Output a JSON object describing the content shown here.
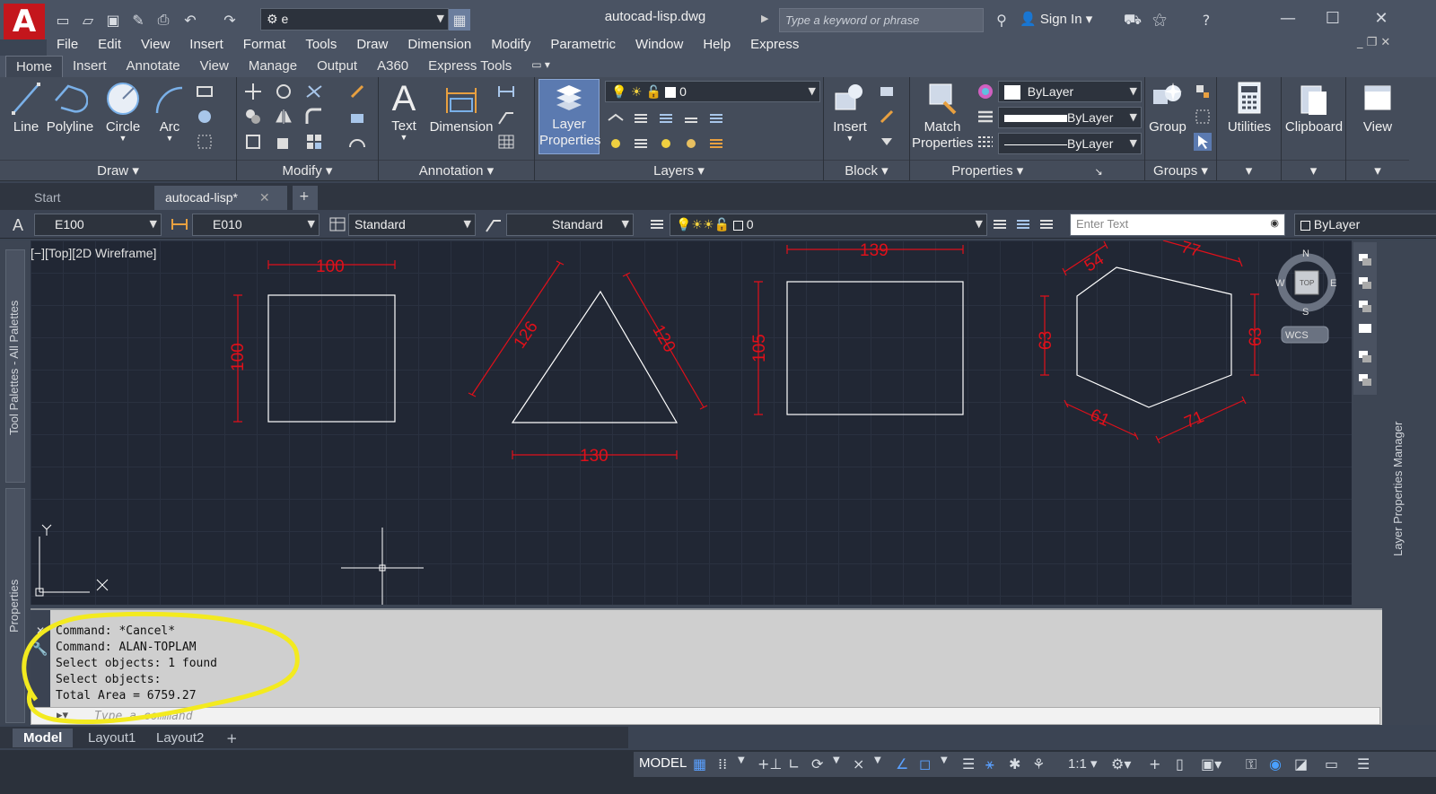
{
  "title_bar": {
    "app_logo": "A",
    "workspace": "e",
    "document_title": "autocad-lisp.dwg",
    "search_placeholder": "Type a keyword or phrase",
    "sign_in": "Sign In"
  },
  "menu": [
    "File",
    "Edit",
    "View",
    "Insert",
    "Format",
    "Tools",
    "Draw",
    "Dimension",
    "Modify",
    "Parametric",
    "Window",
    "Help",
    "Express"
  ],
  "ribbon_tabs": [
    "Home",
    "Insert",
    "Annotate",
    "View",
    "Manage",
    "Output",
    "A360",
    "Express Tools"
  ],
  "ribbon": {
    "draw": {
      "line": "Line",
      "polyline": "Polyline",
      "circle": "Circle",
      "arc": "Arc",
      "panel": "Draw"
    },
    "modify": {
      "panel": "Modify"
    },
    "annotation": {
      "text": "Text",
      "dimension": "Dimension",
      "panel": "Annotation"
    },
    "layers": {
      "layer_properties_1": "Layer",
      "layer_properties_2": "Properties",
      "current_layer": "0",
      "panel": "Layers"
    },
    "block": {
      "insert": "Insert",
      "panel": "Block"
    },
    "properties": {
      "match_1": "Match",
      "match_2": "Properties",
      "color": "ByLayer",
      "lineweight": "ByLayer",
      "linetype": "ByLayer",
      "panel": "Properties"
    },
    "groups": {
      "group": "Group",
      "panel": "Groups"
    },
    "utilities": "Utilities",
    "clipboard": "Clipboard",
    "view": "View"
  },
  "file_tabs": {
    "start": "Start",
    "current": "autocad-lisp*"
  },
  "prop_bar": {
    "text_style": "E100",
    "dim_style": "E010",
    "table_style": "Standard",
    "mleader_style": "Standard",
    "layer": "0",
    "enter_text_placeholder": "Enter Text",
    "bylayer": "ByLayer"
  },
  "viewport": {
    "label": "[−][Top][2D Wireframe]",
    "viewcube": {
      "top": "TOP",
      "n": "N",
      "s": "S",
      "e": "E",
      "w": "W",
      "wcs": "WCS"
    },
    "ucs": {
      "x": "X",
      "y": "Y"
    }
  },
  "drawing": {
    "square": {
      "width": "100",
      "height": "100"
    },
    "triangle": {
      "left": "126",
      "right": "120",
      "base": "130"
    },
    "rectangle": {
      "width": "139",
      "height": "105"
    },
    "hexagon": {
      "top_left": "54",
      "top_right": "77",
      "left": "63",
      "right": "63",
      "bottom_left": "61",
      "bottom_right": "71"
    },
    "colors": {
      "geometry": "#ffffff",
      "dimension": "#e0101a"
    }
  },
  "palettes": {
    "tool_palettes": "Tool Palettes - All Palettes",
    "properties": "Properties",
    "layer_manager": "Layer Properties Manager"
  },
  "command_history": [
    "Command: *Cancel*",
    "Command: ALAN-TOPLAM",
    "Select objects: 1 found",
    "Select objects:",
    "Total Area = 6759.27"
  ],
  "command_placeholder": "Type a command",
  "layout_tabs": [
    "Model",
    "Layout1",
    "Layout2"
  ],
  "status": {
    "model": "MODEL",
    "scale": "1:1"
  }
}
